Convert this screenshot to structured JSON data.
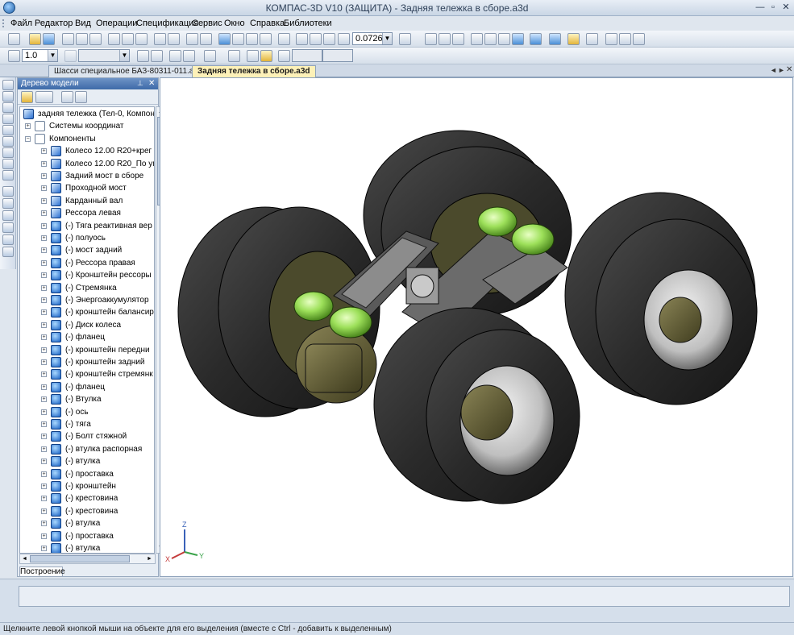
{
  "window": {
    "title": "КОМПАС-3D V10 (ЗАЩИТА) - Задняя тележка в сборе.a3d"
  },
  "menu": [
    "Файл",
    "Редактор",
    "Вид",
    "Операции",
    "Спецификация",
    "Сервис",
    "Окно",
    "Справка",
    "Библиотеки"
  ],
  "toolbar": {
    "zoom_value": "0.0726",
    "step_value": "1.0"
  },
  "tabs": [
    {
      "label": "Шасси специальное БАЗ-80311-011.a3d",
      "active": false
    },
    {
      "label": "Задняя тележка в сборе.a3d",
      "active": true
    }
  ],
  "tree": {
    "header": "Дерево модели",
    "root": "задняя тележка (Тел-0, Компоне",
    "items": [
      {
        "label": "Системы координат",
        "level": 1,
        "icon": "coord-system-icon"
      },
      {
        "label": "Компоненты",
        "level": 1,
        "icon": "components-icon"
      },
      {
        "label": "Колесо 12.00 R20+крег",
        "level": 2,
        "icon": "assembly-icon"
      },
      {
        "label": "Колесо 12.00 R20_По уг",
        "level": 2,
        "icon": "assembly-icon"
      },
      {
        "label": "Задний мост в сборе",
        "level": 2,
        "icon": "assembly-icon"
      },
      {
        "label": "Проходной мост",
        "level": 2,
        "icon": "assembly-icon"
      },
      {
        "label": "Карданный вал",
        "level": 2,
        "icon": "assembly-icon"
      },
      {
        "label": "Рессора левая",
        "level": 2,
        "icon": "assembly-icon"
      },
      {
        "label": "(-) Тяга реактивная вер",
        "level": 2,
        "icon": "part-icon"
      },
      {
        "label": "(-) полуось",
        "level": 2,
        "icon": "part-icon"
      },
      {
        "label": "(-) мост задний",
        "level": 2,
        "icon": "part-icon"
      },
      {
        "label": "(-) Рессора правая",
        "level": 2,
        "icon": "part-icon"
      },
      {
        "label": "(-) Кронштейн рессоры",
        "level": 2,
        "icon": "part-icon"
      },
      {
        "label": "(-) Стремянка",
        "level": 2,
        "icon": "part-icon"
      },
      {
        "label": "(-) Энергоаккумулятор",
        "level": 2,
        "icon": "part-icon"
      },
      {
        "label": "(-) кронштейн балансир",
        "level": 2,
        "icon": "part-icon"
      },
      {
        "label": "(-) Диск колеса",
        "level": 2,
        "icon": "part-icon"
      },
      {
        "label": "(-) фланец",
        "level": 2,
        "icon": "part-icon"
      },
      {
        "label": "(-) кронштейн передни",
        "level": 2,
        "icon": "part-icon"
      },
      {
        "label": "(-) кронштейн задний",
        "level": 2,
        "icon": "part-icon"
      },
      {
        "label": "(-) кронштейн стремянк",
        "level": 2,
        "icon": "part-icon"
      },
      {
        "label": "(-) фланец",
        "level": 2,
        "icon": "part-icon"
      },
      {
        "label": "(-) Втулка",
        "level": 2,
        "icon": "part-icon"
      },
      {
        "label": "(-) ось",
        "level": 2,
        "icon": "part-icon"
      },
      {
        "label": "(-) тяга",
        "level": 2,
        "icon": "part-icon"
      },
      {
        "label": "(-) Болт стяжной",
        "level": 2,
        "icon": "part-icon"
      },
      {
        "label": "(-) втулка распорная",
        "level": 2,
        "icon": "part-icon"
      },
      {
        "label": "(-) втулка",
        "level": 2,
        "icon": "part-icon"
      },
      {
        "label": "(-) проставка",
        "level": 2,
        "icon": "part-icon"
      },
      {
        "label": "(-) кронштейн",
        "level": 2,
        "icon": "part-icon"
      },
      {
        "label": "(-) крестовина",
        "level": 2,
        "icon": "part-icon"
      },
      {
        "label": "(-) крестовина",
        "level": 2,
        "icon": "part-icon"
      },
      {
        "label": "(-) втулка",
        "level": 2,
        "icon": "part-icon"
      },
      {
        "label": "(-) проставка",
        "level": 2,
        "icon": "part-icon"
      },
      {
        "label": "(-) втулка",
        "level": 2,
        "icon": "part-icon"
      }
    ],
    "bottom_tab": "Построение"
  },
  "axes": {
    "x": "X",
    "y": "Y",
    "z": "Z"
  },
  "status": "Щелкните левой кнопкой мыши на объекте для его выделения (вместе с Ctrl - добавить к выделенным)"
}
